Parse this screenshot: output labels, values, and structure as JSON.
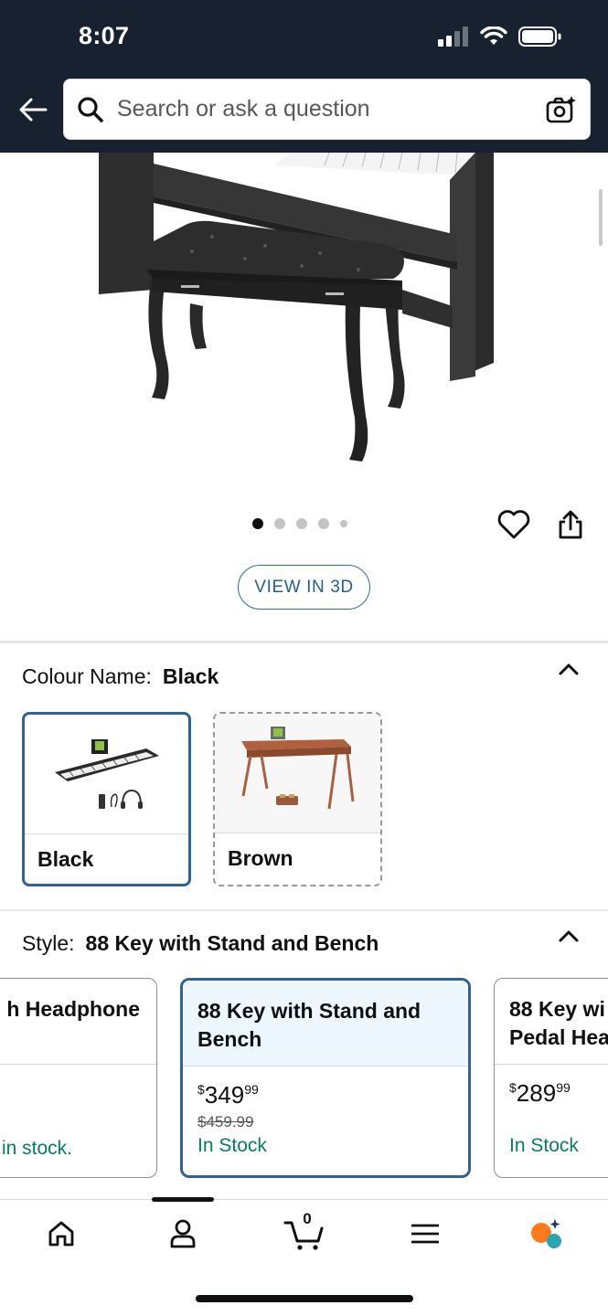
{
  "status_bar": {
    "time": "8:07"
  },
  "search": {
    "placeholder": "Search or ask a question"
  },
  "gallery": {
    "dot_count": 5,
    "active_dot": 0
  },
  "view_3d_label": "VIEW IN 3D",
  "colour": {
    "label": "Colour Name:",
    "selected": "Black",
    "options": [
      {
        "name": "Black",
        "selected": true,
        "available": true
      },
      {
        "name": "Brown",
        "selected": false,
        "available": false
      }
    ]
  },
  "style": {
    "label": "Style:",
    "selected": "88 Key with Stand and Bench",
    "cards": [
      {
        "title": "h Headphone",
        "stock": "in stock."
      },
      {
        "title": "88 Key with Stand and Bench",
        "price_symbol": "$",
        "price_whole": "349",
        "price_cents": "99",
        "was_price": "$459.99",
        "stock": "In Stock",
        "selected": true
      },
      {
        "title": "88 Key wi Pedal Hea",
        "title_line1": "88 Key wi",
        "title_line2": "Pedal Hea",
        "price_symbol": "$",
        "price_whole": "289",
        "price_cents": "99",
        "stock": "In Stock"
      }
    ]
  },
  "bottom_nav": {
    "items": [
      "home-icon",
      "account-icon",
      "cart-icon",
      "menu-icon",
      "rufus-icon"
    ],
    "cart_count": "0"
  },
  "colors": {
    "header_bg": "#172130",
    "accent_blue": "#2f6395",
    "in_stock_green": "#067d62",
    "rufus_orange": "#ff7a1a",
    "rufus_teal": "#2aa6b3"
  }
}
